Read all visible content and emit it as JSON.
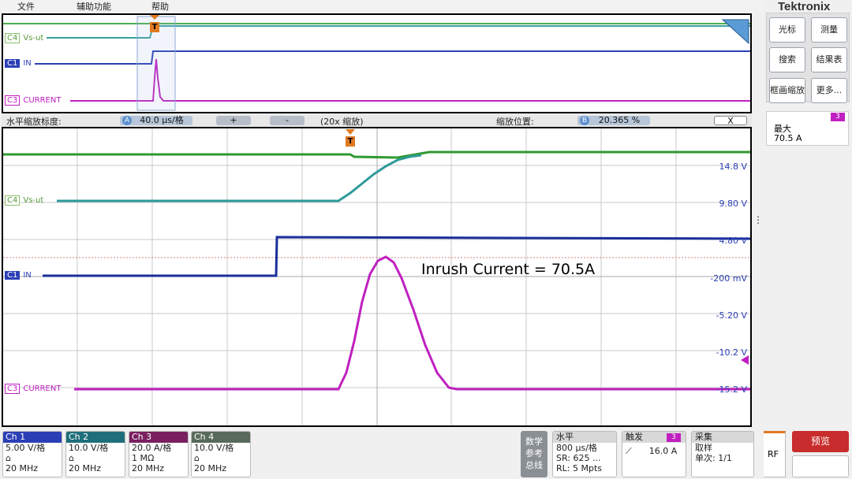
{
  "menu": {
    "file": "文件",
    "utility": "辅助功能",
    "help": "帮助"
  },
  "brand": "Tektronix",
  "overview": {
    "channels": [
      {
        "id": "C4",
        "label": "Vs-ut",
        "color": "#5cb85c"
      },
      {
        "id": "C1",
        "label": "IN",
        "color": "#2b3fb5"
      },
      {
        "id": "C3",
        "label": "CURRENT",
        "color": "#c020c0"
      }
    ],
    "trigger_marker": "T"
  },
  "zoom_bar": {
    "label": "水平缩放标度:",
    "scale_badge": "A",
    "scale_value": "40.0 µs/格",
    "plus": "+",
    "minus": "-",
    "zoom_factor": "(20x 缩放)",
    "position_label": "缩放位置:",
    "position_badge": "B",
    "position_value": "20.365 %",
    "close": "X"
  },
  "main_plot": {
    "annotation": "Inrush Current = 70.5A",
    "channel_labels": [
      {
        "id": "C4",
        "label": "Vs-ut",
        "color": "#3aa0a0"
      },
      {
        "id": "C1",
        "label": "IN",
        "color": "#1a2f9a"
      },
      {
        "id": "C3",
        "label": "CURRENT",
        "color": "#c020c0"
      }
    ],
    "scale_labels": [
      "14.8 V",
      "9.80 V",
      "4.80 V",
      "-200 mV",
      "-5.20 V",
      "-10.2 V",
      "-15.2 V"
    ],
    "trigger_marker": "T"
  },
  "right_panel": {
    "buttons": [
      "光标",
      "测量",
      "搜索",
      "结果表",
      "框画缩放",
      "更多..."
    ],
    "measurement": {
      "channel": "3",
      "name": "最大",
      "value": "70.5 A"
    }
  },
  "bottom": {
    "channels": [
      {
        "name": "Ch 1",
        "scale": "5.00 V/格",
        "imp": "",
        "bw": "20 MHz",
        "color": "#2b3fb5"
      },
      {
        "name": "Ch 2",
        "scale": "10.0 V/格",
        "imp": "",
        "bw": "20 MHz",
        "color": "#1f6f7a"
      },
      {
        "name": "Ch 3",
        "scale": "20.0 A/格",
        "imp": "1 MΩ",
        "bw": "20 MHz",
        "color": "#7a2060"
      },
      {
        "name": "Ch 4",
        "scale": "10.0 V/格",
        "imp": "",
        "bw": "20 MHz",
        "color": "#5a6a5a"
      }
    ],
    "math_ref_bus": "数学\n参考\n总线",
    "horizontal": {
      "title": "水平",
      "scale": "800 µs/格",
      "sr": "SR: 625 ...",
      "rl": "RL: 5 Mpts"
    },
    "trigger": {
      "title": "触发",
      "channel": "3",
      "level": "16.0 A"
    },
    "acquisition": {
      "title": "采集",
      "mode": "取样",
      "count": "单次: 1/1"
    },
    "rf": "RF",
    "preview": "预览"
  }
}
